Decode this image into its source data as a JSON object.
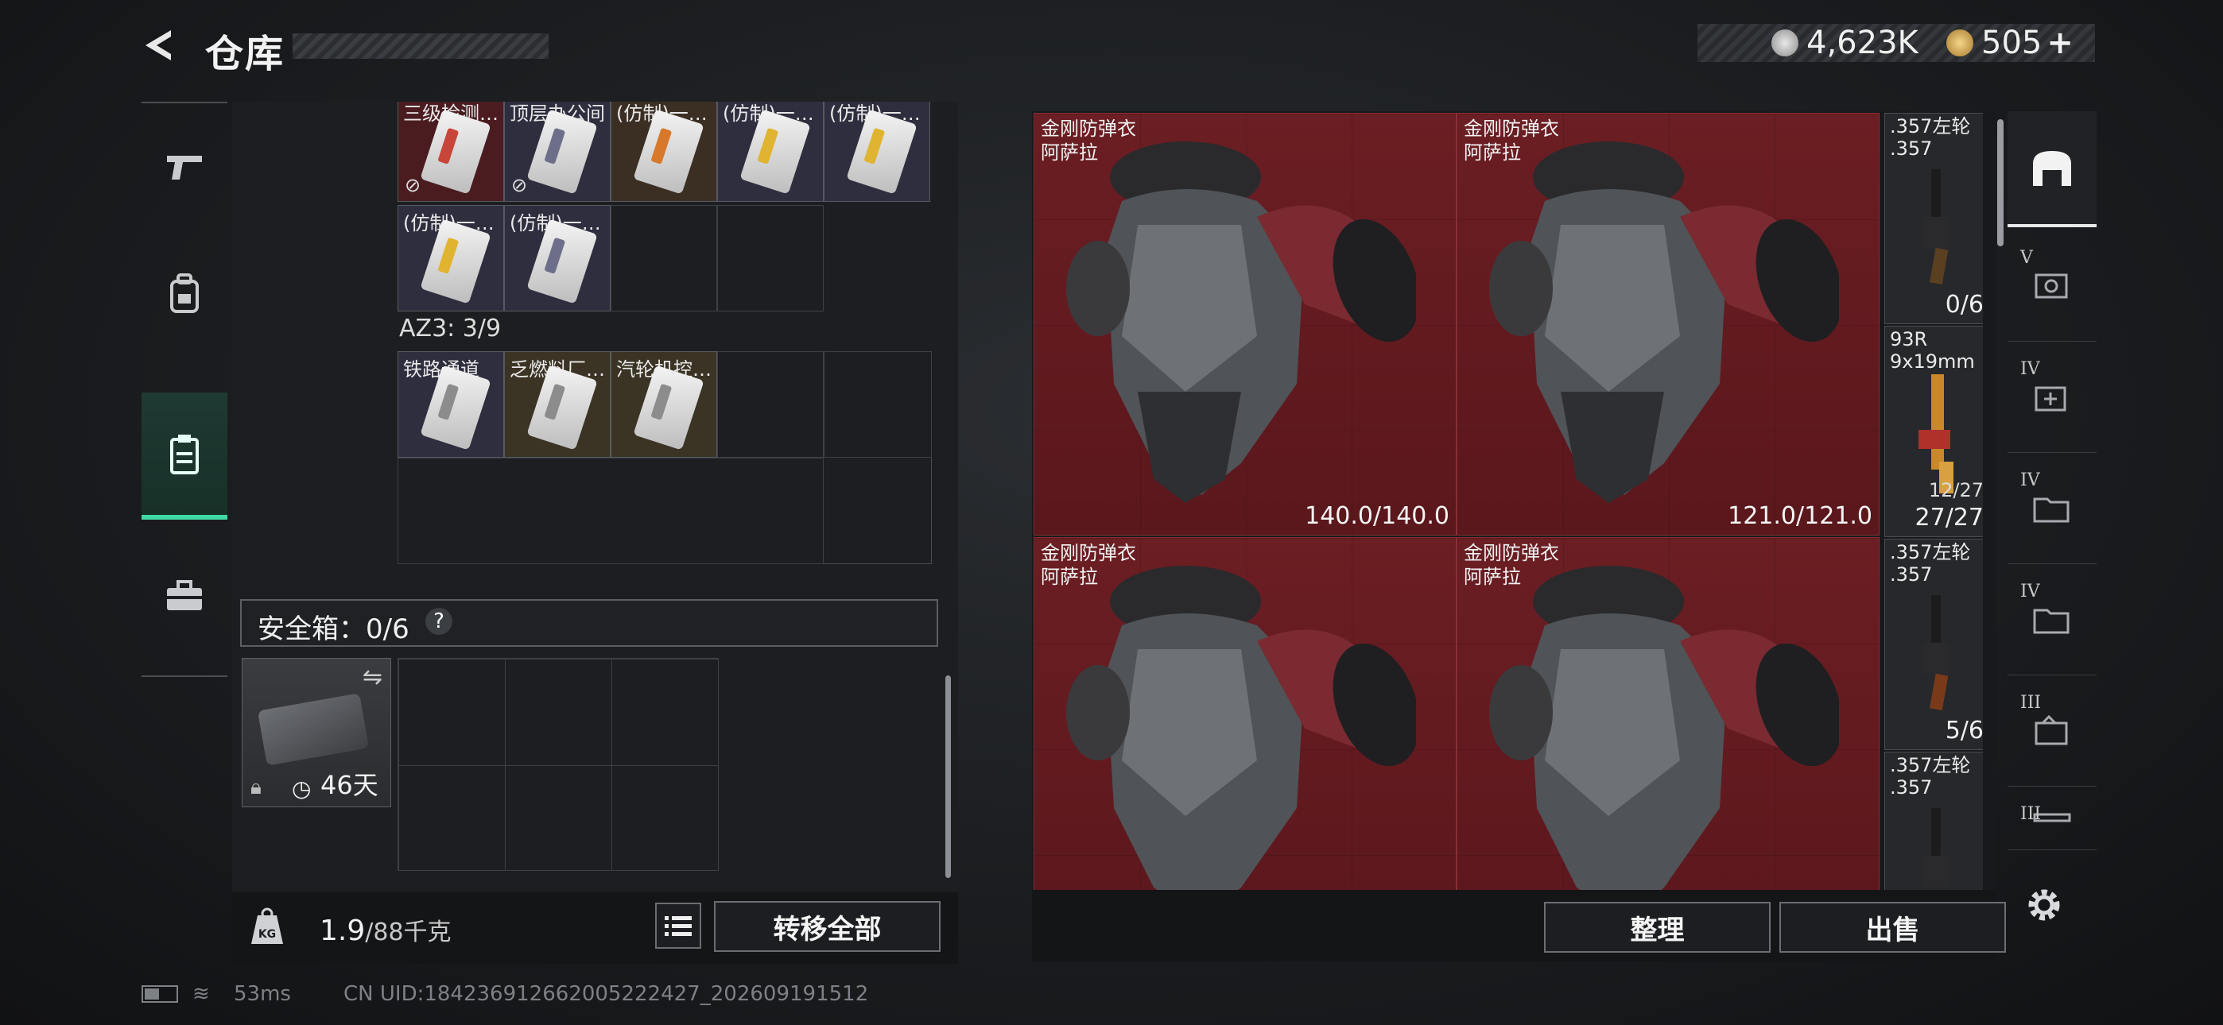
{
  "header": {
    "title": "仓库"
  },
  "currency": {
    "silver": "4,623K",
    "gold": "505",
    "gold_plus": "+"
  },
  "inventory": {
    "row1_items": [
      "三级检测…",
      "顶层办公间",
      "(仿制)一…",
      "(仿制)一…",
      "(仿制)一…"
    ],
    "row2_items": [
      "(仿制)一…",
      "(仿制)一…"
    ],
    "az3_label": "AZ3: 3/9",
    "az3_items": [
      "铁路通道",
      "乏燃料厂…",
      "汽轮机控…"
    ]
  },
  "safe_box": {
    "label": "安全箱：0/6",
    "help": "?",
    "days": "46天"
  },
  "bottom": {
    "weight": "1.9",
    "capacity": "/88千克",
    "transfer_all": "转移全部"
  },
  "armor": {
    "name_line1": "金刚防弹衣",
    "name_line2": "阿萨拉",
    "durability": [
      "140.0/140.0",
      "121.0/121.0",
      "",
      ""
    ]
  },
  "weapons": [
    {
      "name1": ".357左轮",
      "name2": ".357",
      "count": "0/6"
    },
    {
      "name1": "93R",
      "name2": "9x19mm",
      "count": "27/27",
      "ammo": "12/27"
    },
    {
      "name1": ".357左轮",
      "name2": ".357",
      "count": "5/6"
    },
    {
      "name1": ".357左轮",
      "name2": ".357",
      "count": ""
    }
  ],
  "actions": {
    "sort": "整理",
    "sell": "出售"
  },
  "side_tiers": [
    "V",
    "IV",
    "IV",
    "IV",
    "III",
    "III"
  ],
  "status": {
    "latency": "53ms",
    "uid": "CN UID:18423691266200522​2427_202609191512"
  },
  "colors": {
    "accent": "#3fd9a4",
    "armor_bg": "#6b1e23"
  }
}
